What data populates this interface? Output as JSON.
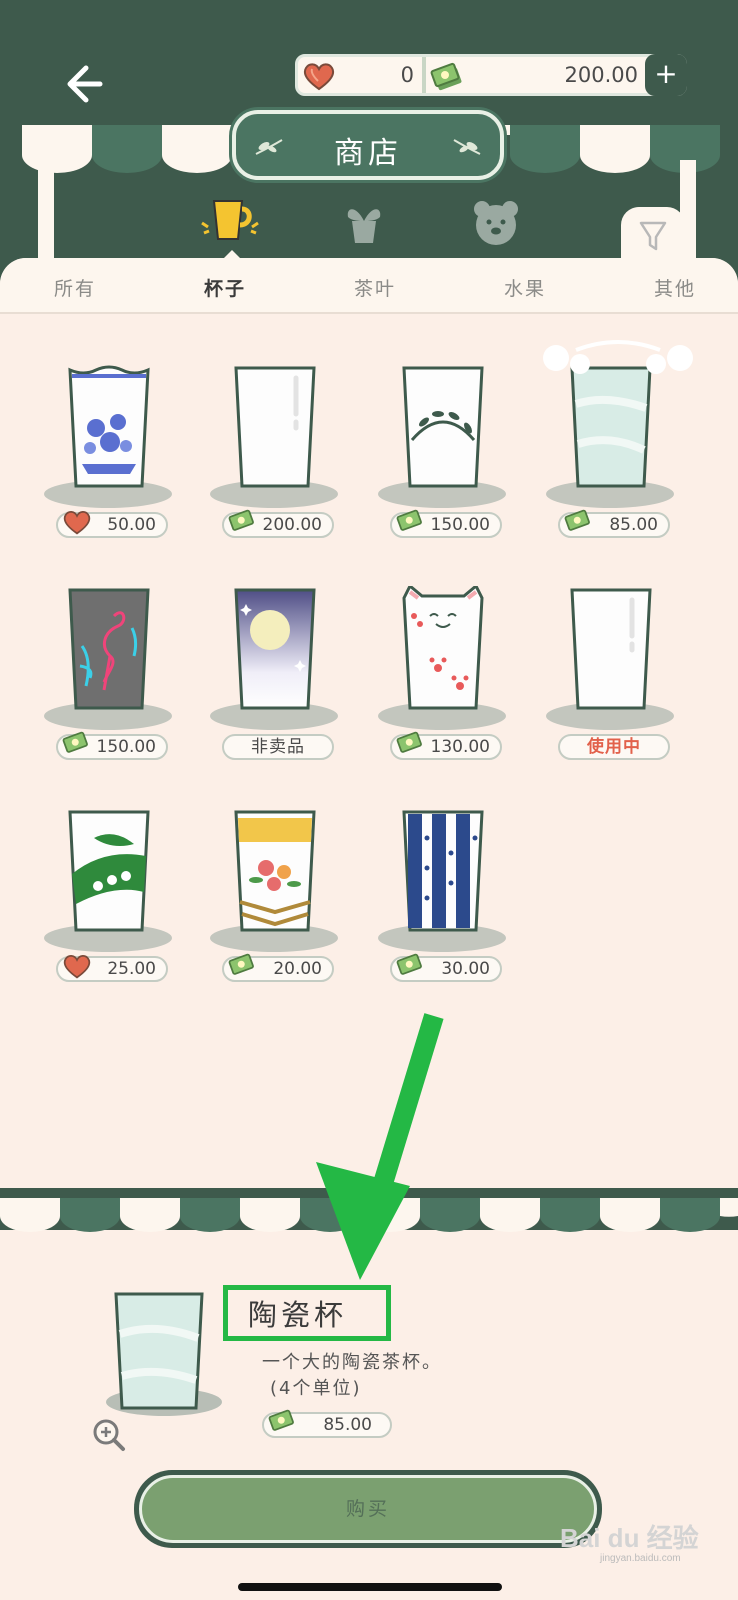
{
  "header": {
    "title": "商店",
    "hearts": "0",
    "money": "200.00",
    "add_symbol": "+"
  },
  "tabs": [
    {
      "label": "所有",
      "active": false
    },
    {
      "label": "杯子",
      "active": true
    },
    {
      "label": "茶叶",
      "active": false
    },
    {
      "label": "水果",
      "active": false
    },
    {
      "label": "其他",
      "active": false
    }
  ],
  "categories": [
    "cup-icon",
    "plant-icon",
    "bear-icon"
  ],
  "items": [
    {
      "name": "blue-floral-cup",
      "currency": "heart",
      "price": "50.00"
    },
    {
      "name": "plain-glass-cup",
      "currency": "money",
      "price": "200.00"
    },
    {
      "name": "vine-cup",
      "currency": "money",
      "price": "150.00"
    },
    {
      "name": "ceramic-cup",
      "currency": "money",
      "price": "85.00"
    },
    {
      "name": "flamingo-cup",
      "currency": "money",
      "price": "150.00"
    },
    {
      "name": "moon-cup",
      "currency": "none",
      "price": "非卖品"
    },
    {
      "name": "cat-cup",
      "currency": "money",
      "price": "130.00"
    },
    {
      "name": "glass-cup-in-use",
      "currency": "none",
      "price": "使用中"
    },
    {
      "name": "lily-cup",
      "currency": "heart",
      "price": "25.00"
    },
    {
      "name": "yellow-floral-cup",
      "currency": "money",
      "price": "20.00"
    },
    {
      "name": "blue-stripe-cup",
      "currency": "money",
      "price": "30.00"
    }
  ],
  "detail": {
    "title": "陶瓷杯",
    "description": "一个大的陶瓷茶杯。",
    "unit": "(4个单位)",
    "price": "85.00"
  },
  "buy_label": "购买",
  "watermark": {
    "logo": "Bai du 经验",
    "url": "jingyan.baidu.com"
  },
  "colors": {
    "primary": "#3e5a4c",
    "accent": "#7ba070",
    "panel": "#fcefe7",
    "highlight": "#24b845",
    "in_use": "#e2614b"
  }
}
